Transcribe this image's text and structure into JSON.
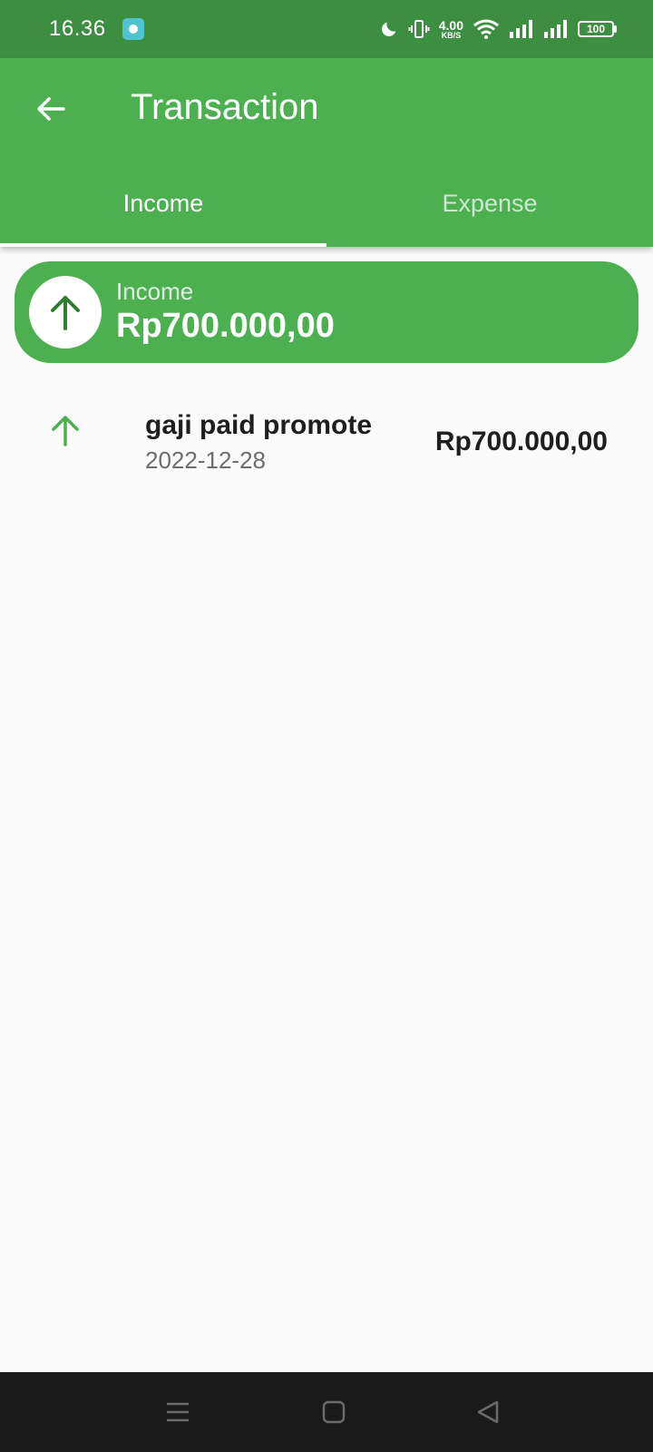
{
  "status_bar": {
    "time": "16.36",
    "net_speed_value": "4.00",
    "net_speed_unit": "KB/S",
    "battery": "100"
  },
  "app_bar": {
    "title": "Transaction"
  },
  "tabs": [
    {
      "label": "Income",
      "active": true
    },
    {
      "label": "Expense",
      "active": false
    }
  ],
  "summary": {
    "label": "Income",
    "amount": "Rp700.000,00"
  },
  "transactions": [
    {
      "title": "gaji paid promote",
      "date": "2022-12-28",
      "amount": "Rp700.000,00",
      "icon": "arrow-up-icon"
    }
  ],
  "colors": {
    "primary": "#4caf50",
    "status_bar": "#3e8e41",
    "icon_dark_green": "#2e7d32",
    "icon_green": "#4caf50",
    "nav_bar": "#1a1a1a"
  }
}
